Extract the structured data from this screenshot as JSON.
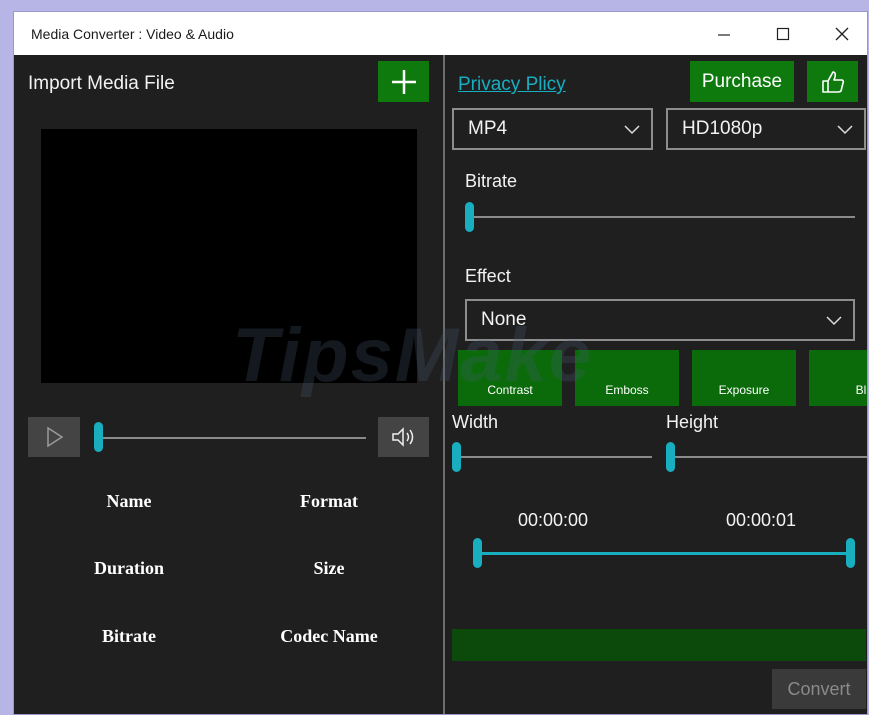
{
  "window": {
    "title": "Media Converter : Video & Audio"
  },
  "left": {
    "import_label": "Import Media File",
    "info": {
      "name": "Name",
      "format": "Format",
      "duration": "Duration",
      "size": "Size",
      "bitrate": "Bitrate",
      "codec_name": "Codec Name"
    },
    "seek_progress": 0
  },
  "right": {
    "privacy_link": "Privacy Plicy",
    "purchase_label": "Purchase",
    "format_selected": "MP4",
    "quality_selected": "HD1080p",
    "bitrate_label": "Bitrate",
    "bitrate_value": 0,
    "effect_label": "Effect",
    "effect_selected": "None",
    "effects": [
      "Contrast",
      "Emboss",
      "Exposure",
      "Blu"
    ],
    "width_label": "Width",
    "height_label": "Height",
    "width_value": 0,
    "height_value": 0,
    "start_time": "00:00:00",
    "end_time": "00:00:01",
    "convert_label": "Convert"
  },
  "watermark": "TipsMake",
  "colors": {
    "accent_green": "#0e7a0e",
    "slider_accent": "#18aec0",
    "background": "#1f1f1f",
    "progress_bar": "#0b4a0b",
    "link": "#18aec0"
  }
}
